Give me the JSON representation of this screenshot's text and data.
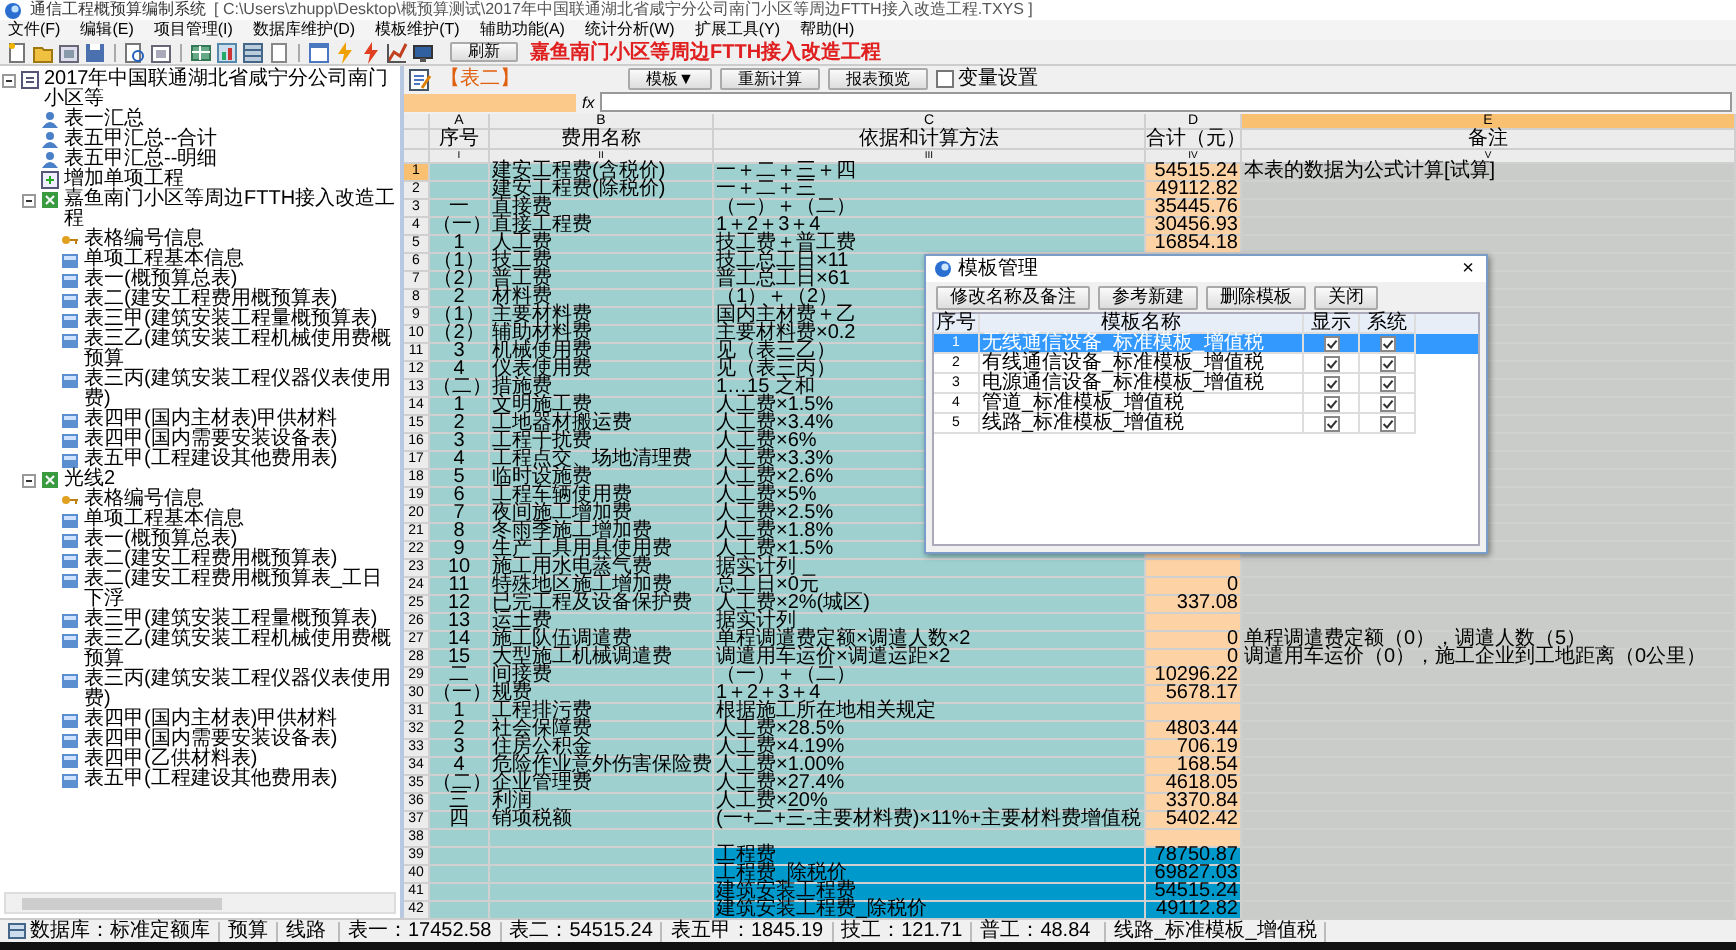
{
  "window": {
    "title": "通信工程概预算编制系统",
    "path": "[ C:\\Users\\zhupp\\Desktop\\概预算测试\\2017年中国联通湖北省咸宁分公司南门小区等周边FTTH接入改造工程.TXYS ]"
  },
  "menu": [
    "文件(F)",
    "编辑(E)",
    "项目管理(I)",
    "数据库维护(D)",
    "模板维护(T)",
    "辅助功能(A)",
    "统计分析(W)",
    "扩展工具(Y)",
    "帮助(H)"
  ],
  "toolbar": {
    "refresh": "刷新",
    "project": "嘉鱼南门小区等周边FTTH接入改造工程"
  },
  "tree": [
    {
      "label": "2017年中国联通湖北省咸宁分公司南门小区等",
      "kind": "document",
      "expanded": true,
      "children": [
        {
          "label": "表一汇总",
          "kind": "person"
        },
        {
          "label": "表五甲汇总--合计",
          "kind": "person"
        },
        {
          "label": "表五甲汇总--明细",
          "kind": "person"
        },
        {
          "label": "增加单项工程",
          "kind": "add"
        },
        {
          "label": "嘉鱼南门小区等周边FTTH接入改造工程",
          "kind": "project",
          "expanded": true,
          "children": [
            {
              "label": "表格编号信息",
              "kind": "key"
            },
            {
              "label": "单项工程基本信息",
              "kind": "sheet"
            },
            {
              "label": "表一(概预算总表)",
              "kind": "sheet"
            },
            {
              "label": "表二(建安工程费用概预算表)",
              "kind": "sheet"
            },
            {
              "label": "表三甲(建筑安装工程量概预算表)",
              "kind": "sheet"
            },
            {
              "label": "表三乙(建筑安装工程机械使用费概预算",
              "kind": "sheet"
            },
            {
              "label": "表三丙(建筑安装工程仪器仪表使用费)",
              "kind": "sheet"
            },
            {
              "label": "表四甲(国内主材表)甲供材料",
              "kind": "sheet"
            },
            {
              "label": "表四甲(国内需要安装设备表)",
              "kind": "sheet"
            },
            {
              "label": "表五甲(工程建设其他费用表)",
              "kind": "sheet"
            }
          ]
        },
        {
          "label": "光线2",
          "kind": "project",
          "expanded": true,
          "children": [
            {
              "label": "表格编号信息",
              "kind": "key"
            },
            {
              "label": "单项工程基本信息",
              "kind": "sheet"
            },
            {
              "label": "表一(概预算总表)",
              "kind": "sheet"
            },
            {
              "label": "表二(建安工程费用概预算表)",
              "kind": "sheet"
            },
            {
              "label": "表二(建安工程费用概预算表_工日下浮",
              "kind": "sheet"
            },
            {
              "label": "表三甲(建筑安装工程量概预算表)",
              "kind": "sheet"
            },
            {
              "label": "表三乙(建筑安装工程机械使用费概预算",
              "kind": "sheet"
            },
            {
              "label": "表三丙(建筑安装工程仪器仪表使用费)",
              "kind": "sheet"
            },
            {
              "label": "表四甲(国内主材表)甲供材料",
              "kind": "sheet"
            },
            {
              "label": "表四甲(国内需要安装设备表)",
              "kind": "sheet"
            },
            {
              "label": "表四甲(乙供材料表)",
              "kind": "sheet"
            },
            {
              "label": "表五甲(工程建设其他费用表)",
              "kind": "sheet"
            }
          ]
        }
      ]
    }
  ],
  "sheet": {
    "title": "【表二】",
    "buttons": [
      "模板▼",
      "重新计算",
      "报表预览"
    ],
    "variable": {
      "label": "变量设置",
      "checked": false
    },
    "fx": "fx"
  },
  "columns": [
    {
      "letter": "A",
      "name": "序号",
      "roman": "I",
      "selected": false
    },
    {
      "letter": "B",
      "name": "费用名称",
      "roman": "II",
      "selected": false
    },
    {
      "letter": "C",
      "name": "依据和计算方法",
      "roman": "III",
      "selected": false
    },
    {
      "letter": "D",
      "name": "合计（元）",
      "roman": "IV",
      "selected": false
    },
    {
      "letter": "E",
      "name": "备注",
      "roman": "V",
      "selected": true
    }
  ],
  "rows": [
    {
      "num": "1",
      "selected": true,
      "kind": "normal",
      "b": "建安工程费(含税价)",
      "c": "一＋二＋三＋四",
      "d": "54515.24",
      "e": "本表的数据为公式计算[试算]"
    },
    {
      "num": "2",
      "selected": false,
      "kind": "normal",
      "b": "建安工程费(除税价)",
      "c": "一＋二＋三",
      "d": "49112.82"
    },
    {
      "num": "3",
      "selected": false,
      "kind": "normal",
      "a": "一",
      "b": "直接费",
      "c": "（一）＋（二）",
      "d": "35445.76"
    },
    {
      "num": "4",
      "selected": false,
      "kind": "normal",
      "a": "（一）",
      "b": "直接工程费",
      "c": "1＋2＋3＋4",
      "d": "30456.93"
    },
    {
      "num": "5",
      "selected": false,
      "kind": "normal",
      "a": "1",
      "b": "人工费",
      "c": "技工费＋普工费",
      "d": "16854.18"
    },
    {
      "num": "6",
      "selected": false,
      "kind": "normal",
      "a": "（1）",
      "b": "技工费",
      "c": "技工总工日×11"
    },
    {
      "num": "7",
      "selected": false,
      "kind": "normal",
      "a": "（2）",
      "b": "普工费",
      "c": "普工总工日×61"
    },
    {
      "num": "8",
      "selected": false,
      "kind": "normal",
      "a": "2",
      "b": "材料费",
      "c": "（1）＋（2）"
    },
    {
      "num": "9",
      "selected": false,
      "kind": "normal",
      "a": "（1）",
      "b": "主要材料费",
      "c": "国内主材费＋乙"
    },
    {
      "num": "10",
      "selected": false,
      "kind": "normal",
      "a": "（2）",
      "b": "辅助材料费",
      "c": "主要材料费×0.2"
    },
    {
      "num": "11",
      "selected": false,
      "kind": "normal",
      "a": "3",
      "b": "机械使用费",
      "c": "见（表三乙）"
    },
    {
      "num": "12",
      "selected": false,
      "kind": "normal",
      "a": "4",
      "b": "仪表使用费",
      "c": "见（表三丙）"
    },
    {
      "num": "13",
      "selected": false,
      "kind": "normal",
      "a": "（二）",
      "b": "措施费",
      "c": "1…15 之和"
    },
    {
      "num": "14",
      "selected": false,
      "kind": "normal",
      "a": "1",
      "b": "文明施工费",
      "c": "人工费×1.5%"
    },
    {
      "num": "15",
      "selected": false,
      "kind": "normal",
      "a": "2",
      "b": "工地器材搬运费",
      "c": "人工费×3.4%"
    },
    {
      "num": "16",
      "selected": false,
      "kind": "normal",
      "a": "3",
      "b": "工程干扰费",
      "c": "人工费×6%"
    },
    {
      "num": "17",
      "selected": false,
      "kind": "normal",
      "a": "4",
      "b": "工程点交、场地清理费",
      "c": "人工费×3.3%"
    },
    {
      "num": "18",
      "selected": false,
      "kind": "normal",
      "a": "5",
      "b": "临时设施费",
      "c": "人工费×2.6%"
    },
    {
      "num": "19",
      "selected": false,
      "kind": "normal",
      "a": "6",
      "b": "工程车辆使用费",
      "c": "人工费×5%"
    },
    {
      "num": "20",
      "selected": false,
      "kind": "normal",
      "a": "7",
      "b": "夜间施工增加费",
      "c": "人工费×2.5%"
    },
    {
      "num": "21",
      "selected": false,
      "kind": "normal",
      "a": "8",
      "b": "冬雨季施工增加费",
      "c": "人工费×1.8%"
    },
    {
      "num": "22",
      "selected": false,
      "kind": "normal",
      "a": "9",
      "b": "生产工具用具使用费",
      "c": "人工费×1.5%"
    },
    {
      "num": "23",
      "selected": false,
      "kind": "normal",
      "a": "10",
      "b": "施工用水电蒸气费",
      "c": "据实计列"
    },
    {
      "num": "24",
      "selected": false,
      "kind": "normal",
      "a": "11",
      "b": "特殊地区施工增加费",
      "c": "总工日×0元",
      "d": "0"
    },
    {
      "num": "25",
      "selected": false,
      "kind": "normal",
      "a": "12",
      "b": "已完工程及设备保护费",
      "c": "人工费×2%(城区)",
      "d": "337.08"
    },
    {
      "num": "26",
      "selected": false,
      "kind": "normal",
      "a": "13",
      "b": "运土费",
      "c": "据实计列"
    },
    {
      "num": "27",
      "selected": false,
      "kind": "normal",
      "a": "14",
      "b": "施工队伍调遣费",
      "c": "单程调遣费定额×调遣人数×2",
      "d": "0",
      "e": "单程调遣费定额（0），调遣人数（5）"
    },
    {
      "num": "28",
      "selected": false,
      "kind": "normal",
      "a": "15",
      "b": "大型施工机械调遣费",
      "c": "调遣用车运价×调遣运距×2",
      "d": "0",
      "e": "调遣用车运价（0），施工企业到工地距离（0公里）"
    },
    {
      "num": "29",
      "selected": false,
      "kind": "normal",
      "a": "二",
      "b": "间接费",
      "c": "（一）＋（二）",
      "d": "10296.22"
    },
    {
      "num": "30",
      "selected": false,
      "kind": "normal",
      "a": "（一）",
      "b": "规费",
      "c": "1＋2＋3＋4",
      "d": "5678.17"
    },
    {
      "num": "31",
      "selected": false,
      "kind": "normal",
      "a": "1",
      "b": "工程排污费",
      "c": "根据施工所在地相关规定"
    },
    {
      "num": "32",
      "selected": false,
      "kind": "normal",
      "a": "2",
      "b": "社会保障费",
      "c": "人工费×28.5%",
      "d": "4803.44"
    },
    {
      "num": "33",
      "selected": false,
      "kind": "normal",
      "a": "3",
      "b": "住房公积金",
      "c": "人工费×4.19%",
      "d": "706.19"
    },
    {
      "num": "34",
      "selected": false,
      "kind": "normal",
      "a": "4",
      "b": "危险作业意外伤害保险费",
      "c": "人工费×1.00%",
      "d": "168.54"
    },
    {
      "num": "35",
      "selected": false,
      "kind": "normal",
      "a": "（二）",
      "b": "企业管理费",
      "c": "人工费×27.4%",
      "d": "4618.05"
    },
    {
      "num": "36",
      "selected": false,
      "kind": "normal",
      "a": "三",
      "b": "利润",
      "c": "人工费×20%",
      "d": "3370.84"
    },
    {
      "num": "37",
      "selected": false,
      "kind": "normal",
      "a": "四",
      "b": "销项税额",
      "c": "(一+二+三-主要材料费)×11%+主要材料费增值税",
      "d": "5402.42"
    },
    {
      "num": "38",
      "selected": false,
      "kind": "normal"
    },
    {
      "num": "39",
      "selected": false,
      "kind": "total",
      "c": "工程费",
      "d": "78750.87"
    },
    {
      "num": "40",
      "selected": false,
      "kind": "total",
      "c": "工程费_除税价",
      "d": "69827.03"
    },
    {
      "num": "41",
      "selected": false,
      "kind": "total",
      "c": "建筑安装工程费",
      "d": "54515.24"
    },
    {
      "num": "42",
      "selected": false,
      "kind": "total",
      "c": "建筑安装工程费_除税价",
      "d": "49112.82"
    }
  ],
  "dialog": {
    "title": "模板管理",
    "close": "×",
    "buttons": [
      "修改名称及备注",
      "参考新建",
      "删除模板",
      "关闭"
    ],
    "columns": [
      "序号",
      "模板名称",
      "显示",
      "系统"
    ],
    "templates": [
      {
        "no": "1",
        "name": "无线通信设备_标准模板_增值税",
        "shown": true,
        "system": true,
        "selected": true
      },
      {
        "no": "2",
        "name": "有线通信设备_标准模板_增值税",
        "shown": true,
        "system": true,
        "selected": false
      },
      {
        "no": "3",
        "name": "电源通信设备_标准模板_增值税",
        "shown": true,
        "system": true,
        "selected": false
      },
      {
        "no": "4",
        "name": "管道_标准模板_增值税",
        "shown": true,
        "system": true,
        "selected": false
      },
      {
        "no": "5",
        "name": "线路_标准模板_增值税",
        "shown": true,
        "system": true,
        "selected": false
      }
    ]
  },
  "status_bar": [
    "数据库：标准定额库",
    "预算",
    "线路",
    "表一：17452.58",
    "表二：54515.24",
    "表五甲：1845.19",
    "技工：121.71",
    "普工：48.84",
    "线路_标准模板_增值税"
  ]
}
